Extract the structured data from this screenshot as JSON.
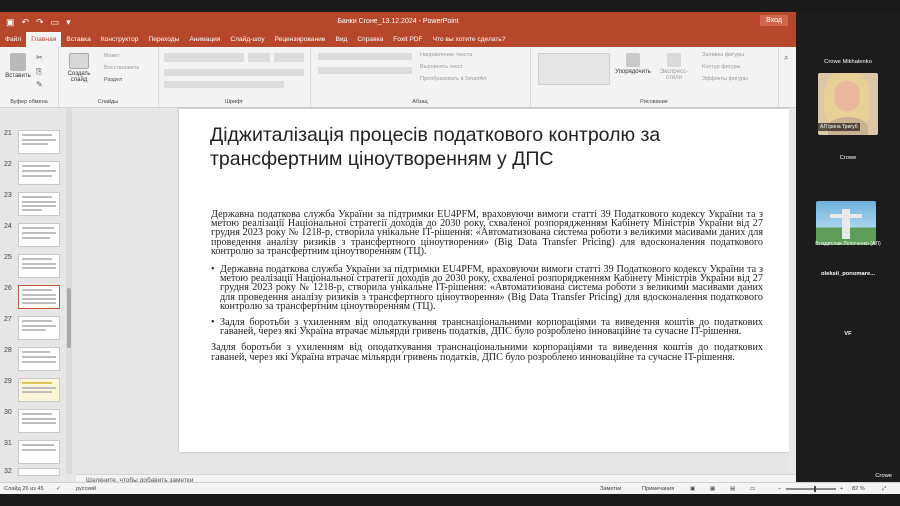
{
  "window": {
    "title": "Банки Сгоне_13.12.2024  -  PowerPoint",
    "login_button": "Вход"
  },
  "ribbon_tabs": [
    {
      "label": "Файл"
    },
    {
      "label": "Главная"
    },
    {
      "label": "Вставка"
    },
    {
      "label": "Конструктор"
    },
    {
      "label": "Переходы"
    },
    {
      "label": "Анимация"
    },
    {
      "label": "Слайд-шоу"
    },
    {
      "label": "Рецензирование"
    },
    {
      "label": "Вид"
    },
    {
      "label": "Справка"
    },
    {
      "label": "Foxit PDF"
    },
    {
      "label": "Что вы хотите сделать?"
    }
  ],
  "ribbon": {
    "paste": "Вставить",
    "create_slide": "Создать слайд",
    "layout": "Макет",
    "reset": "Восстановить",
    "section": "Раздел",
    "text_direction": "Направление текста",
    "align_text": "Выровнять текст",
    "convert_smartart": "Преобразовать в SmartArt",
    "arrange": "Упорядочить",
    "quick_styles": "Экспресс-стили",
    "shape_fill": "Заливка фигуры",
    "shape_outline": "Контур фигуры",
    "shape_effects": "Эффекты фигуры",
    "groups": {
      "clipboard": "Буфер обмена",
      "slides": "Слайды",
      "font": "Шрифт",
      "paragraph": "Абзац",
      "drawing": "Рисование"
    }
  },
  "thumbnails": [
    {
      "num": "21"
    },
    {
      "num": "22"
    },
    {
      "num": "23"
    },
    {
      "num": "24"
    },
    {
      "num": "25"
    },
    {
      "num": "26"
    },
    {
      "num": "27"
    },
    {
      "num": "28"
    },
    {
      "num": "29"
    },
    {
      "num": "30"
    },
    {
      "num": "31"
    },
    {
      "num": "32"
    }
  ],
  "slide": {
    "title": "Діджиталізація процесів податкового контролю за трансфертним ціноутворенням у ДПС",
    "para1": "Державна податкова служба України за підтримки EU4PFM, враховуючи вимоги статті 39 Податкового кодексу України та з метою реалізації Національної стратегії доходів до 2030 року, схваленої розпорядженням Кабінету Міністрів України від 27 грудня 2023 року № 1218-р, створила унікальне IT-рішення: «Автоматизована система роботи з великими масивами даних для проведення аналізу ризиків з трансфертного ціноутворення» (Big Data Transfer Pricing) для вдосконалення податкового контролю за трансфертним ціноутворенням (ТЦ).",
    "bullet1": "Державна податкова служба України за підтримки EU4PFM, враховуючи вимоги статті 39 Податкового кодексу України та з метою реалізації Національної стратегії доходів до 2030 року, схваленої розпорядженням Кабінету Міністрів України від 27 грудня 2023 року № 1218-р, створила унікальне IT-рішення: «Автоматизована система роботи з великими масивами даних для проведення аналізу ризиків з трансфертного ціноутворення» (Big Data Transfer Pricing) для вдосконалення податкового контролю за трансфертним ціноутворенням (ТЦ).",
    "bullet2": "Задля боротьби з ухиленням від оподаткування транснаціональними корпораціями та виведення коштів до податкових гаваней, через які Україна втрачає мільярди гривень податків, ДПС було розроблено інноваційне та сучасне IT-рішення.",
    "para2": "Задля боротьби з ухиленням від оподаткування транснаціональними корпораціями та виведення коштів до податкових гаваней, через які Україна втрачає мільярди гривень податків, ДПС було розроблено инноваційне та сучасне IT-рішення."
  },
  "notes_placeholder": "Щелкните, чтобы добавить заметки",
  "status": {
    "slide_counter": "Слайд 26 из 45",
    "language": "русский",
    "notes": "Заметки",
    "comments": "Примечания",
    "zoom": "82 %"
  },
  "video": {
    "top_label": "Crowe Mikhalenko",
    "tile1_tag": "АЛ Ірина Тригуб",
    "tile2_name": "Crowe",
    "tile3_name": "Владислав Лопоченко (АЛ)",
    "tile4_name": "oleksii_ponomare...",
    "tile5_name": "VF",
    "footer": "Crowe"
  }
}
